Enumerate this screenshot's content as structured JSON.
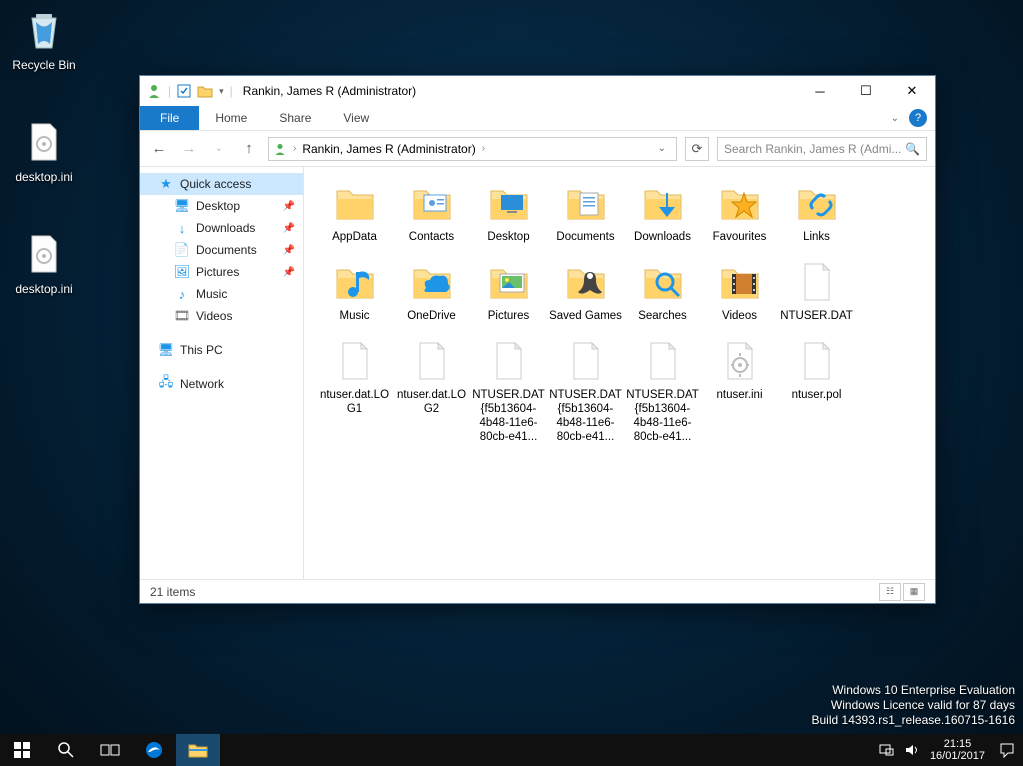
{
  "desktop": {
    "recycle_bin": "Recycle Bin",
    "ini1": "desktop.ini",
    "ini2": "desktop.ini"
  },
  "watermark": {
    "l1": "Windows 10 Enterprise Evaluation",
    "l2": "Windows Licence valid for 87 days",
    "l3": "Build 14393.rs1_release.160715-1616"
  },
  "taskbar": {
    "time": "21:15",
    "date": "16/01/2017"
  },
  "explorer": {
    "title": "Rankin, James R (Administrator)",
    "ribbon": {
      "file": "File",
      "home": "Home",
      "share": "Share",
      "view": "View"
    },
    "breadcrumb": "Rankin, James R (Administrator)",
    "search_placeholder": "Search Rankin, James R (Admi...",
    "status": "21 items",
    "nav": {
      "quick": "Quick access",
      "desktop": "Desktop",
      "downloads": "Downloads",
      "documents": "Documents",
      "pictures": "Pictures",
      "music": "Music",
      "videos": "Videos",
      "thispc": "This PC",
      "network": "Network"
    },
    "items": [
      {
        "name": "AppData",
        "type": "folder"
      },
      {
        "name": "Contacts",
        "type": "folder-contacts"
      },
      {
        "name": "Desktop",
        "type": "folder-desktop"
      },
      {
        "name": "Documents",
        "type": "folder-docs"
      },
      {
        "name": "Downloads",
        "type": "folder-dl"
      },
      {
        "name": "Favourites",
        "type": "folder-fav"
      },
      {
        "name": "Links",
        "type": "folder-links"
      },
      {
        "name": "Music",
        "type": "folder-music"
      },
      {
        "name": "OneDrive",
        "type": "folder-od"
      },
      {
        "name": "Pictures",
        "type": "folder-pics"
      },
      {
        "name": "Saved Games",
        "type": "folder-games"
      },
      {
        "name": "Searches",
        "type": "folder-search"
      },
      {
        "name": "Videos",
        "type": "folder-vid"
      },
      {
        "name": "NTUSER.DAT",
        "type": "file"
      },
      {
        "name": "ntuser.dat.LOG1",
        "type": "file"
      },
      {
        "name": "ntuser.dat.LOG2",
        "type": "file"
      },
      {
        "name": "NTUSER.DAT{f5b13604-4b48-11e6-80cb-e41...",
        "type": "file"
      },
      {
        "name": "NTUSER.DAT{f5b13604-4b48-11e6-80cb-e41...",
        "type": "file"
      },
      {
        "name": "NTUSER.DAT{f5b13604-4b48-11e6-80cb-e41...",
        "type": "file"
      },
      {
        "name": "ntuser.ini",
        "type": "file-ini"
      },
      {
        "name": "ntuser.pol",
        "type": "file"
      }
    ]
  }
}
